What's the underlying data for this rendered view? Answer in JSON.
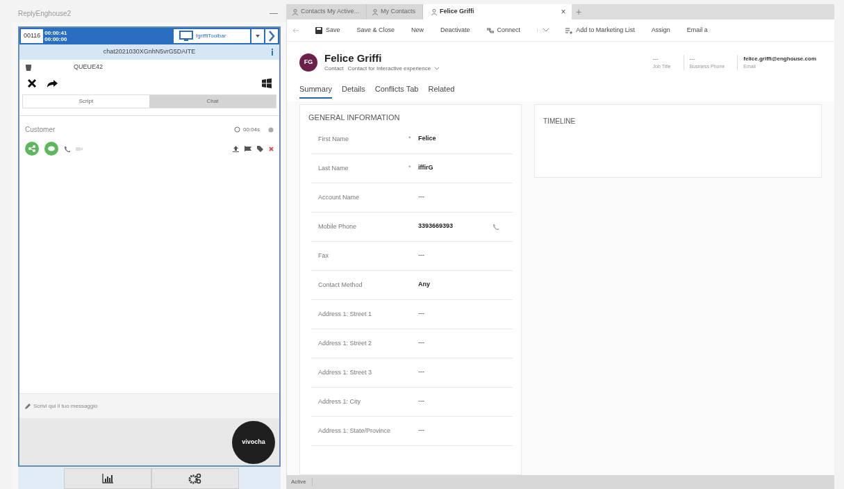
{
  "agent_panel": {
    "title": "ReplyEnghouse2",
    "minimize": "—",
    "extension": "00116",
    "timers": [
      "00:00:41",
      "00:00:00"
    ],
    "toolbar_name": "fgriffiToolbar",
    "chat_id": "chat2021030XGnhN5vrG5DAITE",
    "queue": "QUEUE42",
    "tabs": [
      {
        "label": "Script",
        "selected": false
      },
      {
        "label": "Chat",
        "selected": true
      }
    ],
    "customer": "Customer",
    "elapsed": "00:04s",
    "message_placeholder": "Scrivi qui il tuo messaggio",
    "brand": "vivocha"
  },
  "tabs": [
    {
      "label": "Contacts My Active...",
      "selected": false
    },
    {
      "label": "My Contacts",
      "selected": false
    },
    {
      "label": "Felice Griffi",
      "selected": true
    }
  ],
  "close_tab": "×",
  "add_tab": "+",
  "commands": [
    "Save",
    "Save & Close",
    "New",
    "Deactivate",
    "Connect",
    "Add to Marketing List",
    "Assign",
    "Email a"
  ],
  "record": {
    "initials": "FG",
    "name": "Felice Griffi",
    "entity": "Contact",
    "form": "Contact for Interactive experience",
    "header_fields": [
      {
        "value": "---",
        "label": "Job Title"
      },
      {
        "value": "---",
        "label": "Business Phone"
      },
      {
        "value": "felice.griffi@enghouse.com",
        "label": "Email"
      }
    ]
  },
  "form_tabs": [
    {
      "label": "Summary",
      "selected": true
    },
    {
      "label": "Details",
      "selected": false
    },
    {
      "label": "Conflicts Tab",
      "selected": false
    },
    {
      "label": "Related",
      "selected": false
    }
  ],
  "general_information": {
    "title": "GENERAL INFORMATION",
    "required_marker": "*",
    "fields": [
      {
        "label": "First Name",
        "value": "Felice",
        "required": true,
        "kind": "text"
      },
      {
        "label": "Last Name",
        "value": "iffirG",
        "required": true,
        "kind": "text"
      },
      {
        "label": "Account Name",
        "value": "---",
        "required": false,
        "kind": "text"
      },
      {
        "label": "Mobile Phone",
        "value": "3393669393",
        "required": false,
        "kind": "phone"
      },
      {
        "label": "Fax",
        "value": "---",
        "required": false,
        "kind": "text"
      },
      {
        "label": "Contact Method",
        "value": "Any",
        "required": false,
        "kind": "text"
      },
      {
        "label": "Address 1: Street 1",
        "value": "---",
        "required": false,
        "kind": "text"
      },
      {
        "label": "Address 1: Street 2",
        "value": "---",
        "required": false,
        "kind": "text"
      },
      {
        "label": "Address 1: Street 3",
        "value": "---",
        "required": false,
        "kind": "text"
      },
      {
        "label": "Address 1: City",
        "value": "---",
        "required": false,
        "kind": "text"
      },
      {
        "label": "Address 1: State/Province",
        "value": "---",
        "required": false,
        "kind": "text"
      }
    ]
  },
  "timeline": {
    "title": "TIMELINE"
  },
  "status_bar": "Active"
}
